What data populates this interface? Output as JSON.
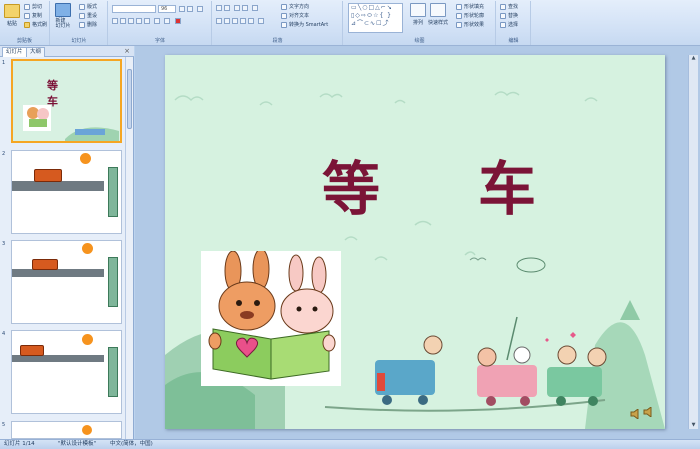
{
  "ribbon": {
    "clipboard": {
      "label": "剪贴板",
      "paste": "粘贴",
      "cut": "剪切",
      "copy": "复制",
      "format_painter": "格式刷"
    },
    "slides": {
      "label": "幻灯片",
      "new_slide": "新建\n幻灯片",
      "layout": "版式",
      "reset": "重设",
      "delete": "删除"
    },
    "font": {
      "label": "字体",
      "size": "96"
    },
    "paragraph": {
      "label": "段落",
      "text_direction": "文字方向",
      "align_text": "对齐文本",
      "smartart": "转换为 SmartArt"
    },
    "drawing": {
      "label": "绘图",
      "arrange": "排列",
      "quick_styles": "快速样式",
      "shape_fill": "形状填充",
      "shape_outline": "形状轮廓",
      "shape_effects": "形状效果"
    },
    "editing": {
      "label": "编辑",
      "find": "查找",
      "replace": "替换",
      "select": "选择"
    }
  },
  "leftpane": {
    "tab_slides": "幻灯片",
    "tab_outline": "大纲",
    "close": "×",
    "thumb1_title": "等 车"
  },
  "slide": {
    "title_left": "等",
    "title_right": "车"
  },
  "status": {
    "slide_info": "幻灯片 1/14",
    "theme": "\"默认设计模板\"",
    "language": "中文(简体，中国)"
  },
  "colors": {
    "title": "#7b1437",
    "slide_bg": "#d6f2e0",
    "selection": "#f5a623"
  }
}
